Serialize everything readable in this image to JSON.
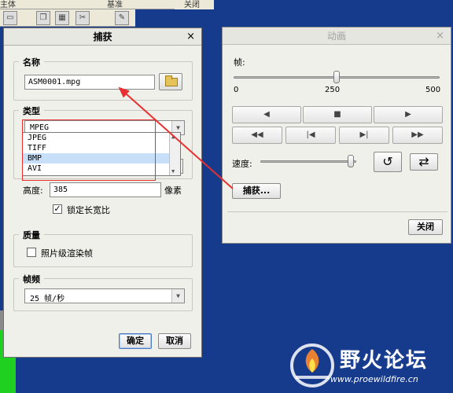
{
  "background": {
    "menubar": {
      "items": [
        "主体",
        "基准",
        "关闭"
      ]
    },
    "toolbar": {
      "button_icons": [
        "folder-icon",
        "copy-icon",
        "grid-icon",
        "cut-icon",
        "snap-icon"
      ]
    }
  },
  "capture": {
    "title": "捕获",
    "name_group": {
      "label": "名称",
      "filename": "ASM0001.mpg"
    },
    "type_group": {
      "label": "类型",
      "selected": "MPEG",
      "options": [
        "JPEG",
        "TIFF",
        "BMP",
        "AVI"
      ],
      "highlighted_option": "BMP"
    },
    "height_label": "高度:",
    "height_value": "385",
    "pixel_unit": "像素",
    "lock_aspect": {
      "label": "锁定长宽比",
      "checked": true
    },
    "quality_group": {
      "label": "质量",
      "photo_render": {
        "label": "照片级渲染帧",
        "checked": false
      }
    },
    "fps_group": {
      "label": "帧频",
      "selected": "25 帧/秒"
    },
    "ok_label": "确定",
    "cancel_label": "取消"
  },
  "animation": {
    "title": "动画",
    "frame_label": "帧:",
    "frame_slider": {
      "min": "0",
      "mid": "250",
      "max": "500",
      "value_fraction": 0.5
    },
    "speed_label": "速度:",
    "speed_fraction": 0.95,
    "capture_button": "捕获...",
    "close_button": "关闭"
  },
  "watermark": {
    "text": "野火论坛",
    "url": "www.proewildfire.cn"
  },
  "annotation_color": "#e83030"
}
